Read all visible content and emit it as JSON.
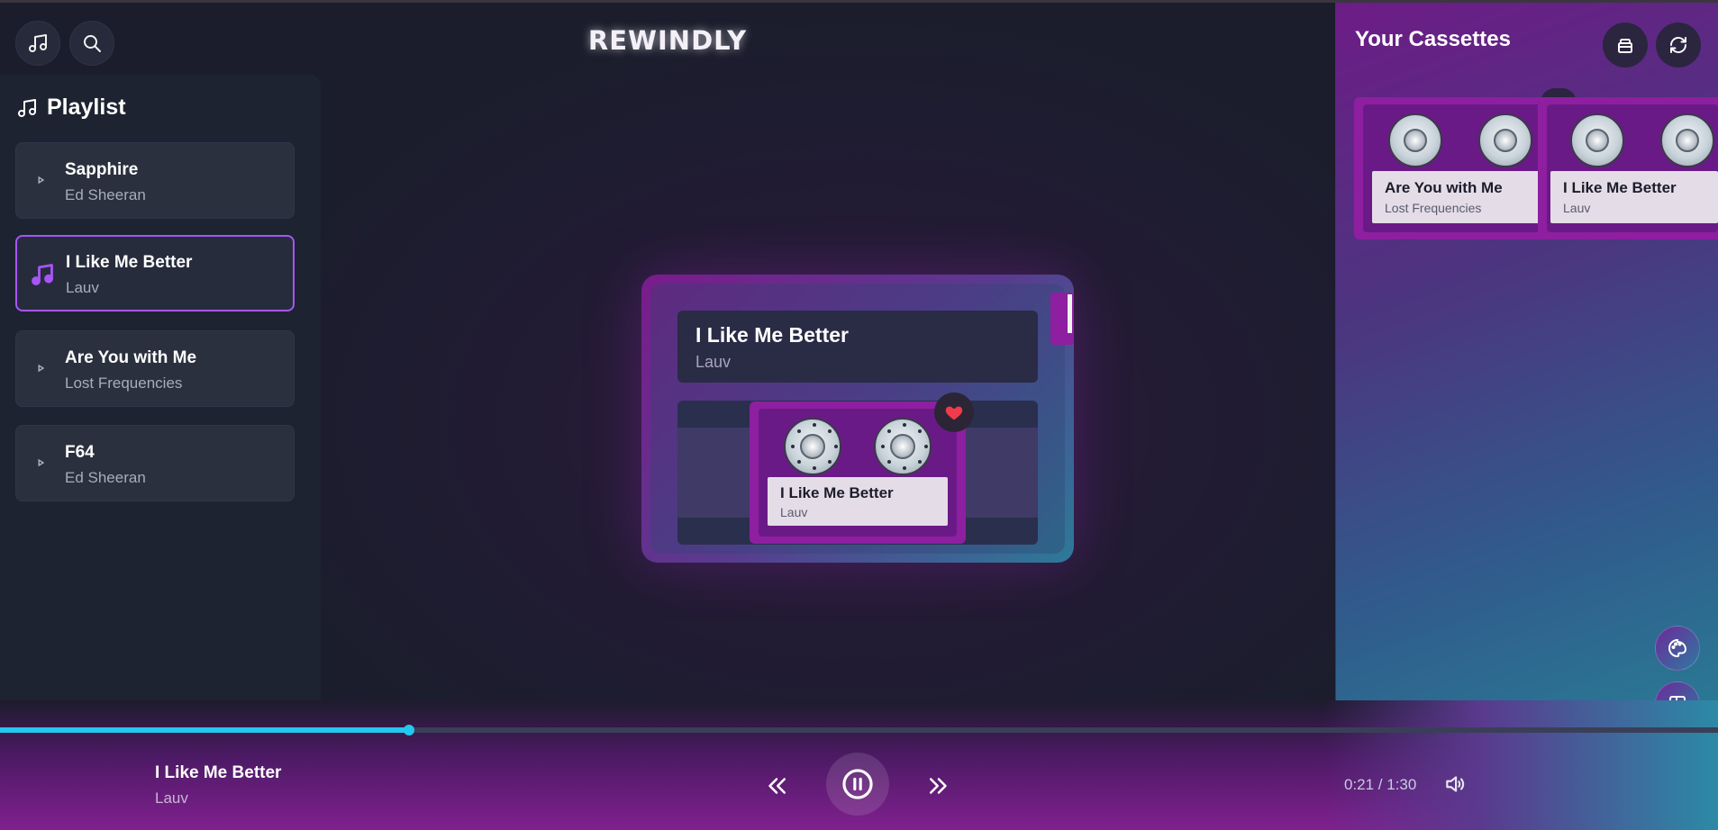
{
  "app": {
    "title": "REWINDLY"
  },
  "toolbar": {
    "music_icon": "music-note-icon",
    "search_icon": "search-icon"
  },
  "playlist": {
    "heading": "Playlist",
    "items": [
      {
        "title": "Sapphire",
        "artist": "Ed Sheeran",
        "active": false
      },
      {
        "title": "I Like Me Better",
        "artist": "Lauv",
        "active": true
      },
      {
        "title": "Are You with Me",
        "artist": "Lost Frequencies",
        "active": false
      },
      {
        "title": "F64",
        "artist": "Ed Sheeran",
        "active": false
      }
    ]
  },
  "player": {
    "title": "I Like Me Better",
    "artist": "Lauv",
    "cassette_label_title": "I Like Me Better",
    "cassette_label_artist": "Lauv",
    "favorited": true
  },
  "cassettes": {
    "heading": "Your Cassettes",
    "items": [
      {
        "title": "Are You with Me",
        "artist": "Lost Frequencies"
      },
      {
        "title": "I Like Me Better",
        "artist": "Lauv"
      }
    ]
  },
  "now_playing": {
    "title": "I Like Me Better",
    "artist": "Lauv",
    "time": "0:21 / 1:30",
    "progress": 0.238
  },
  "colors": {
    "accent": "#a855f7",
    "cassette_magenta": "#8e1fa0",
    "progress": "#24c8ee",
    "heart": "#ef3b4a"
  }
}
